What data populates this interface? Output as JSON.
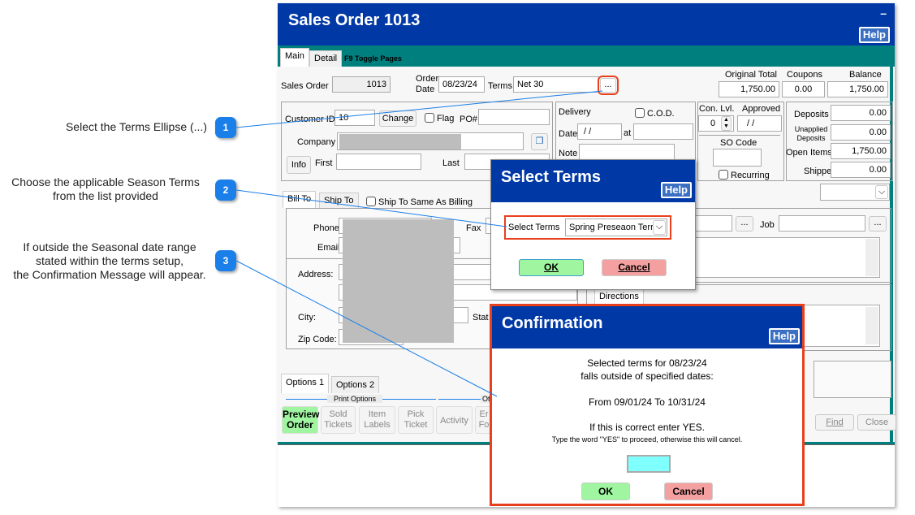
{
  "callouts": [
    {
      "num": "1",
      "text": "Select the Terms Ellipse (...)"
    },
    {
      "num": "2",
      "text_lines": [
        "Choose the applicable Season Terms",
        "from the list provided"
      ]
    },
    {
      "num": "3",
      "text_lines": [
        "If outside the Seasonal date range",
        "stated within the terms setup,",
        "the Confirmation Message will appear."
      ]
    }
  ],
  "window": {
    "title": "Sales Order 1013",
    "minimize": "–",
    "help": "Help",
    "tabs": [
      "Main",
      "Detail"
    ],
    "toggle_hint": "F9 Toggle Pages"
  },
  "header": {
    "sales_order_label": "Sales Order",
    "sales_order_value": "1013",
    "order_date_label": [
      "Order",
      "Date"
    ],
    "order_date_value": "08/23/24",
    "terms_label": "Terms",
    "terms_value": "Net 30",
    "terms_ellipsis": "...",
    "original_total_label": "Original Total",
    "original_total_value": "1,750.00",
    "coupons_label": "Coupons",
    "coupons_value": "0.00",
    "balance_label": "Balance",
    "balance_value": "1,750.00"
  },
  "customer": {
    "customer_id_label": "Customer ID",
    "customer_id_value": "10",
    "change_label": "Change",
    "flag_label": "Flag",
    "po_label": "PO#",
    "company_label": "Company",
    "info_label": "Info",
    "first_label": "First",
    "last_label": "Last"
  },
  "delivery": {
    "label": "Delivery",
    "cod_label": "C.O.D.",
    "date_label": "Date",
    "date_value": " / /",
    "at_label": "at",
    "note_label": "Note"
  },
  "approval": {
    "con_lvl_label": "Con. Lvl.",
    "con_lvl_value": "0",
    "approved_label": "Approved",
    "approved_value": " / /",
    "so_code_label": "SO Code",
    "recurring_label": "Recurring"
  },
  "totals": [
    {
      "label": "Deposits",
      "value": "0.00"
    },
    {
      "label": "Unapplied Deposits",
      "value": "0.00"
    },
    {
      "label": "Open Items",
      "value": "1,750.00"
    },
    {
      "label": "Shipped",
      "value": "0.00"
    }
  ],
  "address": {
    "tabs": [
      "Bill To",
      "Ship To"
    ],
    "same_as_billing": "Ship To Same As Billing",
    "phone_label": "Phone",
    "fax_label": "Fax",
    "email_label": "Email",
    "address_label": "Address:",
    "city_label": "City:",
    "state_label": "Stat",
    "zip_label": "Zip Code:"
  },
  "job_label": "Job",
  "directions_label": "Directions",
  "ellipsis": "...",
  "options": {
    "tabs": [
      "Options 1",
      "Options 2"
    ],
    "print_options_label": "Print Options",
    "other_label": "Ot",
    "buttons": [
      [
        "Preview",
        "Order"
      ],
      [
        "Sold",
        "Tickets"
      ],
      [
        "Item",
        "Labels"
      ],
      [
        "Pick",
        "Ticket"
      ],
      [
        "Activity"
      ],
      [
        "Er",
        "Fo"
      ]
    ],
    "find_label": "Find",
    "close_label": "Close"
  },
  "select_terms_dialog": {
    "title": "Select Terms",
    "help": "Help",
    "field_label": "Select Terms",
    "selected": "Spring Preseaon Terr",
    "ok": "OK",
    "cancel": "Cancel"
  },
  "confirmation_dialog": {
    "title": "Confirmation",
    "help": "Help",
    "line1": "Selected terms for 08/23/24",
    "line2": "falls outside of specified dates:",
    "line3": "From 09/01/24 To 10/31/24",
    "line4": "If this is correct enter YES.",
    "line5": "Type the word \"YES\" to proceed, otherwise this will cancel.",
    "input_value": "",
    "ok": "OK",
    "cancel": "Cancel"
  },
  "colors": {
    "title_blue": "#0039a6",
    "teal": "#007f7f",
    "callout_blue": "#1a7fe8",
    "highlight": "#e8401c",
    "ok_green": "#a0f5a0",
    "cancel_red": "#f5a0a0",
    "yes_input": "#80ffff"
  }
}
